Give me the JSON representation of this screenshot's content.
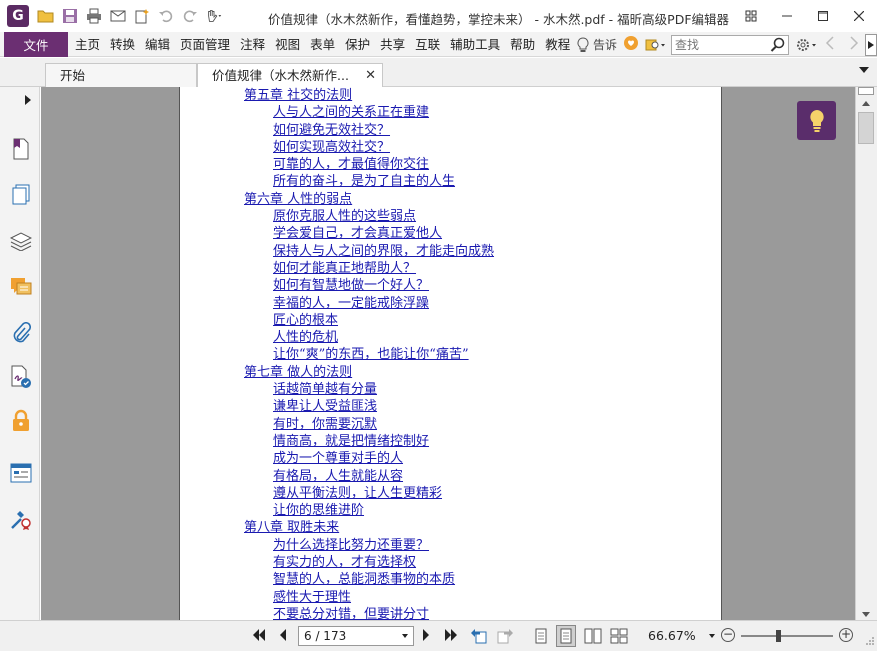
{
  "titlebar": {
    "app_logo": "G",
    "window_title": "价值规律（水木然新作，看懂趋势，掌控未来） - 水木然.pdf - 福昕高级PDF编辑器",
    "quick_access_icons": [
      "open-folder-icon",
      "save-icon",
      "print-icon",
      "email-icon",
      "new-icon",
      "undo-icon",
      "redo-icon",
      "hand-tool-icon"
    ]
  },
  "menubar": {
    "file_label": "文件",
    "items": [
      "主页",
      "转换",
      "编辑",
      "页面管理",
      "注释",
      "视图",
      "表单",
      "保护",
      "共享",
      "互联",
      "辅助工具",
      "帮助",
      "教程"
    ],
    "tell_label": "告诉",
    "search_placeholder": "查找"
  },
  "tabs": [
    {
      "label": "开始"
    },
    {
      "label": "价值规律（水木然新作..."
    }
  ],
  "toc": [
    {
      "type": "chapter",
      "text": "第五章 社交的法则"
    },
    {
      "type": "section",
      "text": "人与人之间的关系正在重建"
    },
    {
      "type": "section",
      "text": "如何避免无效社交？"
    },
    {
      "type": "section",
      "text": "如何实现高效社交？"
    },
    {
      "type": "section",
      "text": "可靠的人，才最值得你交往"
    },
    {
      "type": "section",
      "text": "所有的奋斗，是为了自主的人生"
    },
    {
      "type": "chapter",
      "text": "第六章 人性的弱点"
    },
    {
      "type": "section",
      "text": "原你克服人性的这些弱点"
    },
    {
      "type": "section",
      "text": "学会爱自己，才会真正爱他人"
    },
    {
      "type": "section",
      "text": "保持人与人之间的界限，才能走向成熟"
    },
    {
      "type": "section",
      "text": "如何才能真正地帮助人？"
    },
    {
      "type": "section",
      "text": "如何有智慧地做一个好人？"
    },
    {
      "type": "section",
      "text": "幸福的人，一定能戒除浮躁"
    },
    {
      "type": "section",
      "text": "匠心的根本"
    },
    {
      "type": "section",
      "text": "人性的危机"
    },
    {
      "type": "section",
      "text": "让你“爽”的东西，也能让你“痛苦”"
    },
    {
      "type": "chapter",
      "text": "第七章 做人的法则"
    },
    {
      "type": "section",
      "text": "话越简单越有分量"
    },
    {
      "type": "section",
      "text": "谦卑让人受益匪浅"
    },
    {
      "type": "section",
      "text": "有时，你需要沉默"
    },
    {
      "type": "section",
      "text": "情商高，就是把情绪控制好"
    },
    {
      "type": "section",
      "text": "成为一个尊重对手的人"
    },
    {
      "type": "section",
      "text": "有格局，人生就能从容"
    },
    {
      "type": "section",
      "text": "遵从平衡法则，让人生更精彩"
    },
    {
      "type": "section",
      "text": "让你的思维进阶"
    },
    {
      "type": "chapter",
      "text": "第八章 取胜未来"
    },
    {
      "type": "section",
      "text": "为什么选择比努力还重要？"
    },
    {
      "type": "section",
      "text": "有实力的人，才有选择权"
    },
    {
      "type": "section",
      "text": "智慧的人，总能洞悉事物的本质"
    },
    {
      "type": "section",
      "text": "感性大于理性"
    },
    {
      "type": "section",
      "text": "不要总分对错，但要讲分寸"
    }
  ],
  "statusbar": {
    "page_indicator": "6 / 173",
    "zoom_label": "66.67%",
    "zoom_level": 0.4
  },
  "colors": {
    "brand": "#6b2f72",
    "link": "#1a1ab0",
    "doc_background": "#9a9a9a"
  }
}
